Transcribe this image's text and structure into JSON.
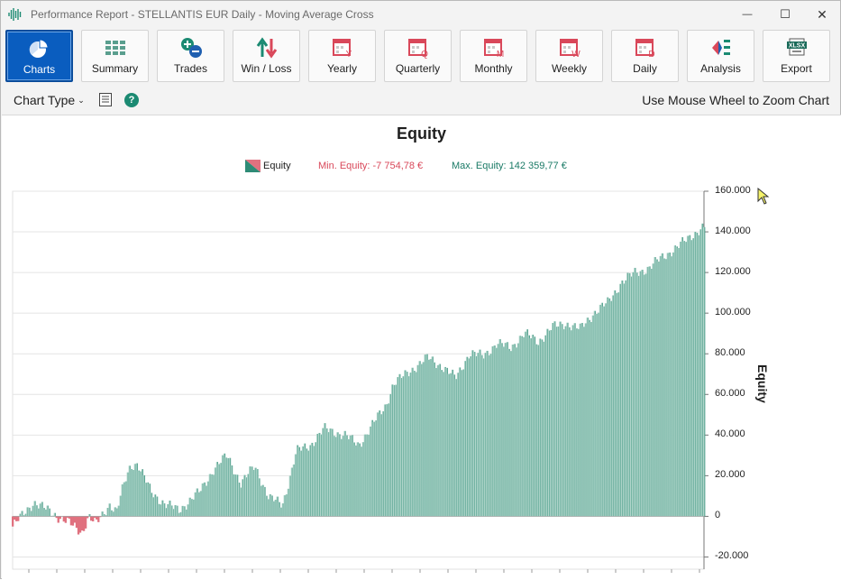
{
  "window": {
    "title": "Performance Report - STELLANTIS EUR Daily - Moving Average Cross",
    "app_icon": "waveform-icon",
    "controls": {
      "minimize": "—",
      "maximize": "☐",
      "close": "✕"
    }
  },
  "toolbar": {
    "buttons": [
      {
        "label": "Charts",
        "icon": "pie-chart-icon",
        "active": true
      },
      {
        "label": "Summary",
        "icon": "grid-icon",
        "active": false
      },
      {
        "label": "Trades",
        "icon": "plus-minus-icon",
        "active": false
      },
      {
        "label": "Win / Loss",
        "icon": "up-down-arrows-icon",
        "active": false
      },
      {
        "label": "Yearly",
        "icon": "calendar-y-icon",
        "letter": "Y",
        "active": false
      },
      {
        "label": "Quarterly",
        "icon": "calendar-q-icon",
        "letter": "Q",
        "active": false
      },
      {
        "label": "Monthly",
        "icon": "calendar-m-icon",
        "letter": "M",
        "active": false
      },
      {
        "label": "Weekly",
        "icon": "calendar-w-icon",
        "letter": "W",
        "active": false
      },
      {
        "label": "Daily",
        "icon": "calendar-d-icon",
        "letter": "D",
        "active": false
      },
      {
        "label": "Analysis",
        "icon": "analysis-icon",
        "active": false
      },
      {
        "label": "Export",
        "icon": "xlsx-icon",
        "badge": "XLSX",
        "active": false
      }
    ]
  },
  "subbar": {
    "chart_type_label": "Chart Type",
    "help_glyph": "?",
    "zoom_hint": "Use Mouse Wheel to Zoom Chart"
  },
  "colors": {
    "accent": "#0a5dbf",
    "equity_positive": "#2e8b76",
    "equity_negative": "#e0717f",
    "min_text": "#d9485a",
    "max_text": "#1a7a66"
  },
  "chart_data": {
    "type": "area",
    "title": "Equity",
    "ylabel": "Equity",
    "legend": {
      "series": "Equity",
      "min_label": "Min. Equity: -7 754,78 €",
      "max_label": "Max. Equity: 142 359,77 €"
    },
    "ylim": [
      -26000,
      160000
    ],
    "y_ticks": [
      "160.000",
      "140.000",
      "120.000",
      "100.000",
      "80.000",
      "60.000",
      "40.000",
      "20.000",
      "0",
      "-20.000"
    ],
    "y_tick_values": [
      160000,
      140000,
      120000,
      100000,
      80000,
      60000,
      40000,
      20000,
      0,
      -20000
    ],
    "min_value": -7754.78,
    "max_value": 142359.77,
    "series_x": [
      0,
      3,
      5,
      8,
      10,
      11,
      12,
      14,
      15,
      16,
      17,
      18,
      20,
      22,
      24,
      27,
      29,
      31,
      33,
      35,
      37,
      39,
      40,
      41,
      43,
      45,
      48,
      50,
      52,
      54,
      55,
      58,
      60,
      62,
      64,
      66,
      68,
      70,
      72,
      74,
      76,
      78,
      80,
      82,
      84,
      86,
      88,
      90,
      92,
      94,
      96,
      98,
      100
    ],
    "series_y": [
      -5000,
      7000,
      3000,
      -3000,
      -7754.78,
      0,
      -4000,
      6000,
      2000,
      15000,
      25000,
      26000,
      12000,
      6000,
      3000,
      12000,
      23000,
      30000,
      16000,
      25000,
      9000,
      6000,
      18000,
      32000,
      35000,
      43000,
      40000,
      35000,
      45000,
      55000,
      65000,
      73000,
      78000,
      74000,
      68000,
      80000,
      79000,
      85000,
      83000,
      90000,
      86000,
      93000,
      95000,
      92000,
      100000,
      105000,
      115000,
      120000,
      122000,
      128000,
      132000,
      138000,
      142359.77
    ]
  }
}
